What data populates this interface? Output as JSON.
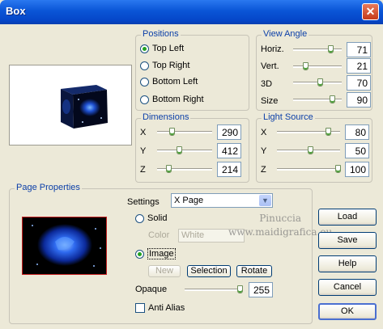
{
  "window": {
    "title": "Box",
    "close_glyph": "✕"
  },
  "positions": {
    "title": "Positions",
    "options": [
      {
        "label": "Top Left",
        "selected": true
      },
      {
        "label": "Top Right",
        "selected": false
      },
      {
        "label": "Bottom Left",
        "selected": false
      },
      {
        "label": "Bottom Right",
        "selected": false
      }
    ]
  },
  "view_angle": {
    "title": "View Angle",
    "rows": [
      {
        "label": "Horiz.",
        "value": "71"
      },
      {
        "label": "Vert.",
        "value": "21"
      },
      {
        "label": "3D",
        "value": "70"
      },
      {
        "label": "Size",
        "value": "90"
      }
    ]
  },
  "dimensions": {
    "title": "Dimensions",
    "rows": [
      {
        "label": "X",
        "value": "290"
      },
      {
        "label": "Y",
        "value": "412"
      },
      {
        "label": "Z",
        "value": "214"
      }
    ]
  },
  "light_source": {
    "title": "Light Source",
    "rows": [
      {
        "label": "X",
        "value": "80"
      },
      {
        "label": "Y",
        "value": "50"
      },
      {
        "label": "Z",
        "value": "100"
      }
    ]
  },
  "page_properties": {
    "title": "Page Properties",
    "settings_label": "Settings",
    "settings_value": "X Page",
    "solid_label": "Solid",
    "color_label": "Color",
    "color_value": "White",
    "image_label": "Image",
    "new_label": "New",
    "selection_label": "Selection",
    "rotate_label": "Rotate",
    "opaque_label": "Opaque",
    "opaque_value": "255",
    "anti_alias_label": "Anti Alias",
    "solid_selected": false,
    "image_selected": true,
    "anti_alias_checked": false
  },
  "buttons": {
    "load": "Load",
    "save": "Save",
    "help": "Help",
    "cancel": "Cancel",
    "ok": "OK"
  },
  "watermark": {
    "line1": "Pinuccia",
    "line2": "www.maidigrafica.eu"
  },
  "colors": {
    "title_bar": "#0a55d6",
    "group_title": "#0b3fa8",
    "background": "#ece9d8"
  }
}
